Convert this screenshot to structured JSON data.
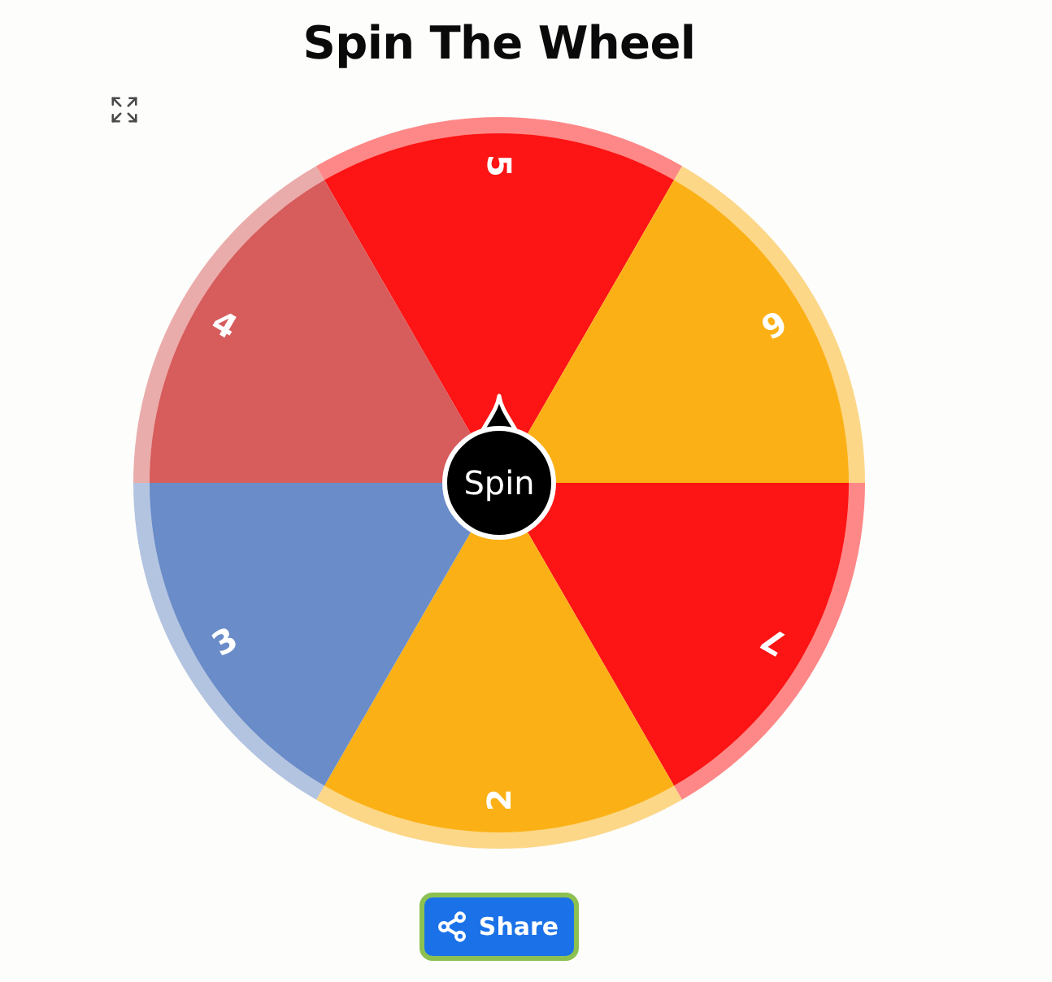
{
  "title": "Spin The Wheel",
  "wheel": {
    "segments": [
      {
        "label": "5",
        "color": "#fd1414"
      },
      {
        "label": "6",
        "color": "#fbb116"
      },
      {
        "label": "7",
        "color": "#fd1414"
      },
      {
        "label": "2",
        "color": "#fbb116"
      },
      {
        "label": "3",
        "color": "#6a8cc8"
      },
      {
        "label": "4",
        "color": "#d75c5c"
      }
    ],
    "spin_button": "Spin"
  },
  "share_button": "Share"
}
